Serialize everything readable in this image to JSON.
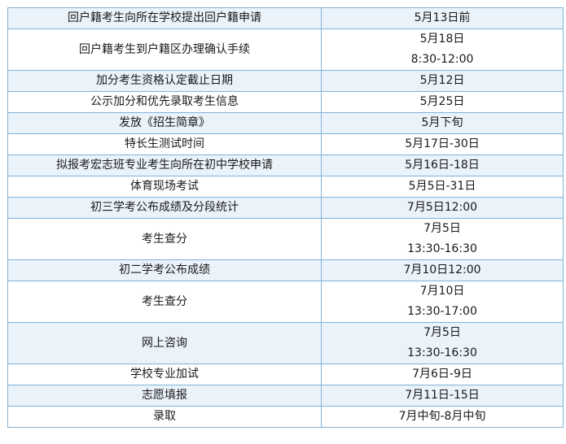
{
  "rows": [
    {
      "item": "回户籍考生向所在学校提出回户籍申请",
      "time": [
        "5月13日前"
      ]
    },
    {
      "item": "回户籍考生到户籍区办理确认手续",
      "time": [
        "5月18日",
        "8:30-12:00"
      ]
    },
    {
      "item": "加分考生资格认定截止日期",
      "time": [
        "5月12日"
      ]
    },
    {
      "item": "公示加分和优先录取考生信息",
      "time": [
        "5月25日"
      ]
    },
    {
      "item": "发放《招生简章》",
      "time": [
        "5月下旬"
      ]
    },
    {
      "item": "特长生测试时间",
      "time": [
        "5月17日-30日"
      ]
    },
    {
      "item": "拟报考宏志班专业考生向所在初中学校申请",
      "time": [
        "5月16日-18日"
      ]
    },
    {
      "item": "体育现场考试",
      "time": [
        "5月5日-31日"
      ]
    },
    {
      "item": "初三学考公布成绩及分段统计",
      "time": [
        "7月5日12:00"
      ]
    },
    {
      "item": "考生查分",
      "time": [
        "7月5日",
        "13:30-16:30"
      ]
    },
    {
      "item": "初二学考公布成绩",
      "time": [
        "7月10日12:00"
      ]
    },
    {
      "item": "考生查分",
      "time": [
        "7月10日",
        "13:30-17:00"
      ]
    },
    {
      "item": "网上咨询",
      "time": [
        "7月5日",
        "13:30-16:30"
      ]
    },
    {
      "item": "学校专业加试",
      "time": [
        "7月6日-9日"
      ]
    },
    {
      "item": "志愿填报",
      "time": [
        "7月11日-15日"
      ]
    },
    {
      "item": "录取",
      "time": [
        "7月中旬-8月中旬"
      ]
    }
  ],
  "colors": {
    "border": "#7fb2da",
    "row_shaded": "#eaf2fa",
    "row_plain": "#ffffff"
  }
}
